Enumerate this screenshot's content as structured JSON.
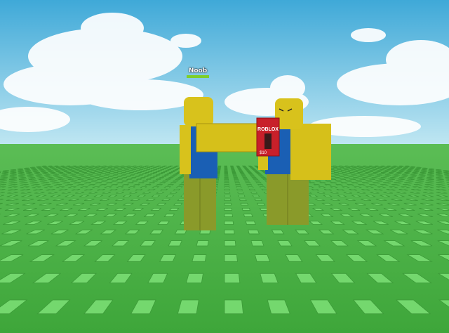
{
  "player": {
    "name": "Noob",
    "health_fraction": 1.0
  },
  "gift_card": {
    "brand": "ROBLOX",
    "value": "$10"
  },
  "colors": {
    "sky_top": "#3fa9d8",
    "sky_bottom": "#bfe6f2",
    "ground": "#4fb64a",
    "tile": "#6fd66a",
    "head": "#d8c21c",
    "torso": "#1a5fb4",
    "legs": "#8a9a2a",
    "card": "#c8202a",
    "health": "#7ecf2a"
  }
}
